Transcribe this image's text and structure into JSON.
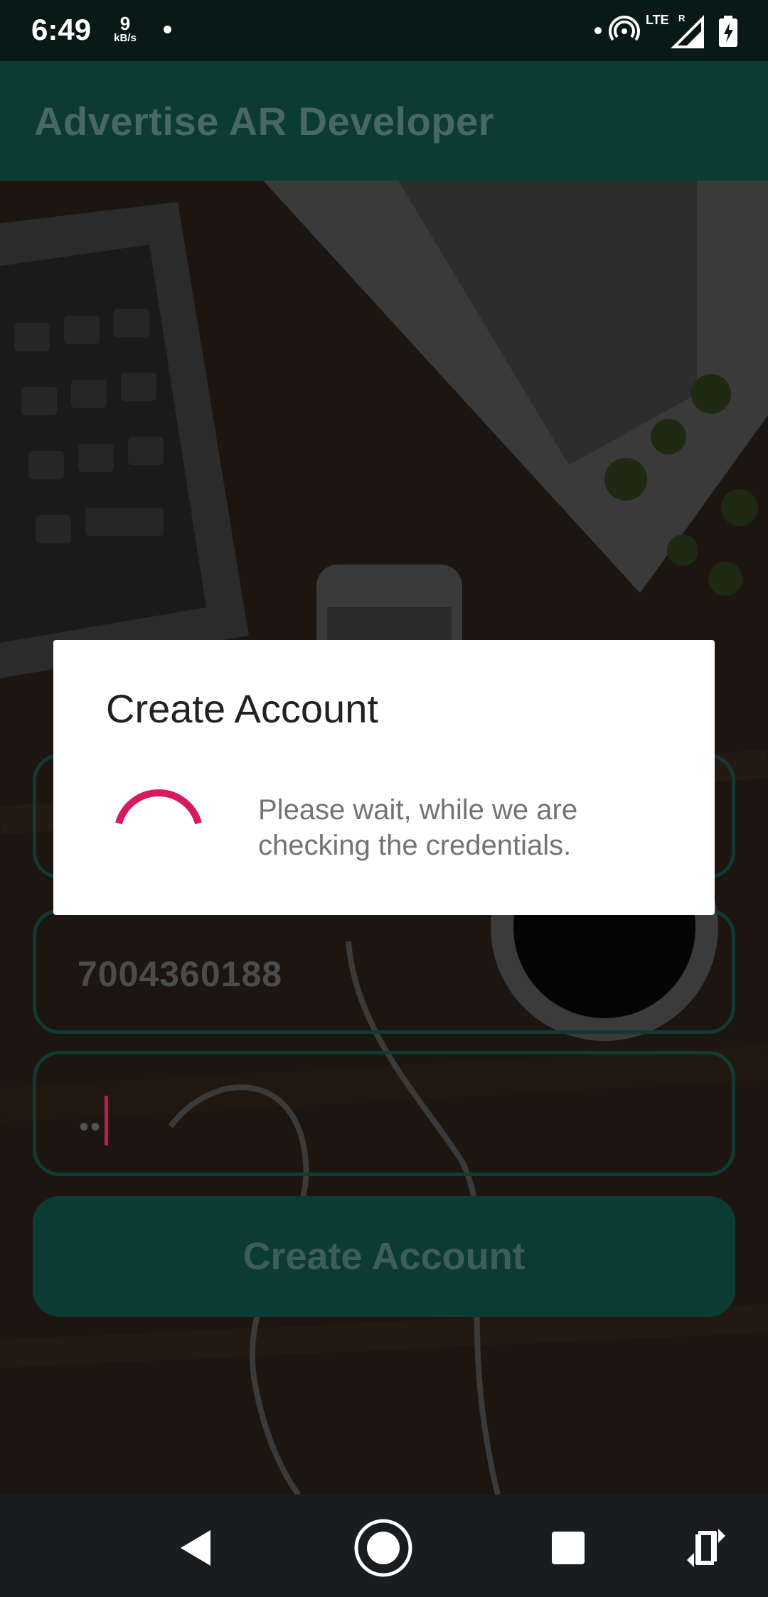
{
  "status_bar": {
    "time": "6:49",
    "net_speed_value": "9",
    "net_speed_unit": "kB/s",
    "network": "LTE",
    "roaming": "R"
  },
  "app_bar": {
    "title": "Advertise AR Developer"
  },
  "form": {
    "phone_value": "7004360188",
    "password_value": "••",
    "create_button_label": "Create Account"
  },
  "dialog": {
    "title": "Create Account",
    "message": "Please wait, while we are checking the credentials."
  },
  "colors": {
    "primary": "#0c3b33",
    "accent": "#d81b60",
    "status_bar": "#081916",
    "nav_bar": "#1a1d1f"
  },
  "icons": {
    "nav_back": "back-icon",
    "nav_home": "home-icon",
    "nav_recent": "recent-apps-icon",
    "nav_rotate": "rotate-icon"
  }
}
